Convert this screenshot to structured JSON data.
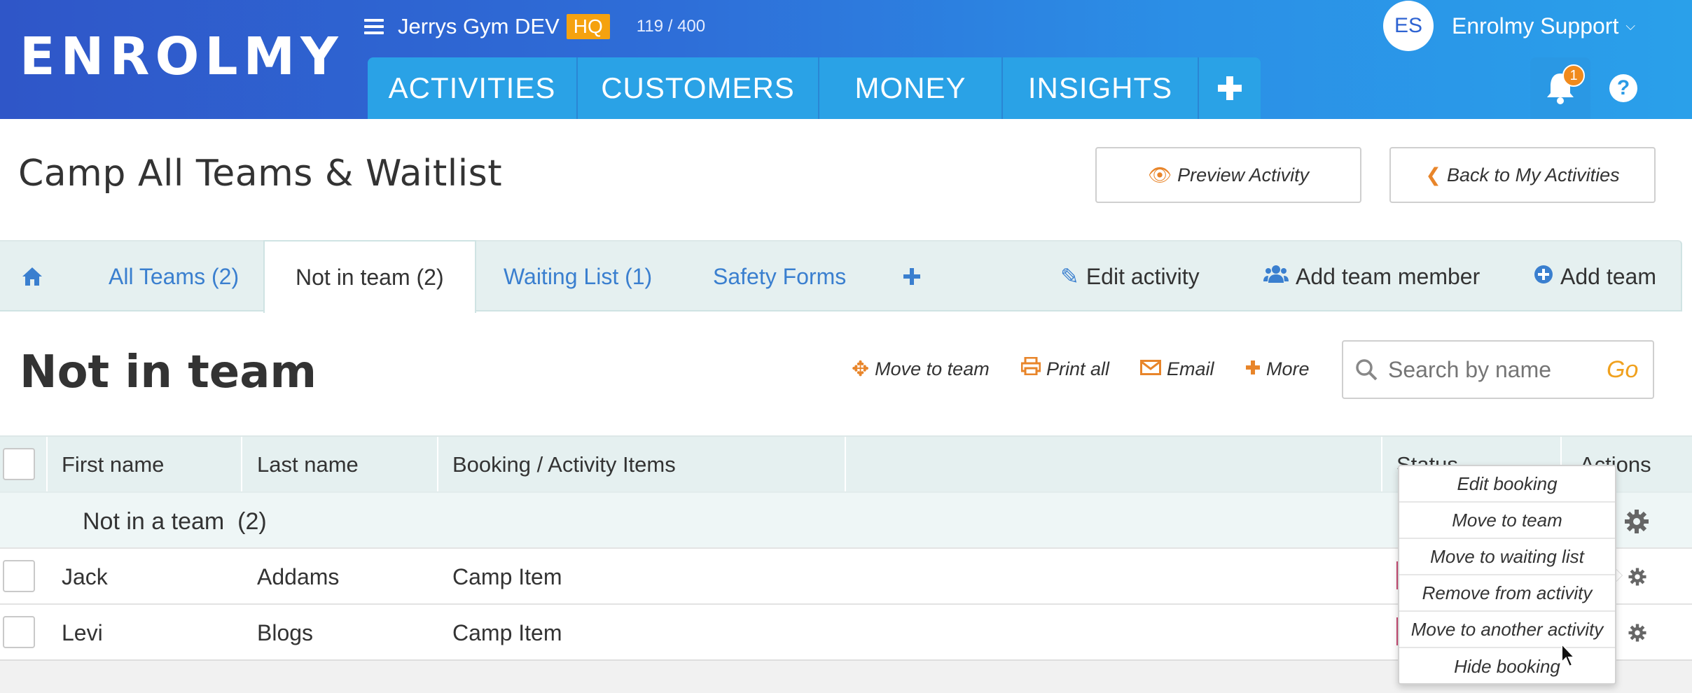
{
  "brand": {
    "logo": "ENROLMY"
  },
  "org": {
    "name": "Jerrys Gym DEV",
    "hq_badge": "HQ",
    "count": "119 / 400"
  },
  "nav": {
    "tabs": [
      "ACTIVITIES",
      "CUSTOMERS",
      "MONEY",
      "INSIGHTS"
    ],
    "add_icon": "plus-icon"
  },
  "user": {
    "initials": "ES",
    "name": "Enrolmy Support",
    "notifications": "1",
    "help": "?"
  },
  "page": {
    "title": "Camp All Teams & Waitlist",
    "preview_label": "Preview Activity",
    "back_label": "Back to My Activities"
  },
  "tabs": {
    "items": [
      "All Teams (2)",
      "Not in team (2)",
      "Waiting List (1)",
      "Safety Forms"
    ],
    "active": "Not in team (2)",
    "edit_activity": "Edit activity",
    "add_member": "Add team member",
    "add_team": "Add team"
  },
  "section": {
    "title": "Not in team",
    "move_to_team": "Move to team",
    "print_all": "Print all",
    "email": "Email",
    "more": "More",
    "search_placeholder": "Search by name",
    "go": "Go"
  },
  "table": {
    "headers": [
      "First name",
      "Last name",
      "Booking / Activity Items",
      "Status",
      "Actions"
    ],
    "group_label": "Not in a team",
    "group_count": "(2)",
    "rows": [
      {
        "first": "Jack",
        "last": "Addams",
        "item": "Camp Item"
      },
      {
        "first": "Levi",
        "last": "Blogs",
        "item": "Camp Item"
      }
    ]
  },
  "dropdown": {
    "items": [
      "Edit booking",
      "Move to team",
      "Move to waiting list",
      "Remove from activity",
      "Move to another activity",
      "Hide booking"
    ]
  },
  "colors": {
    "accent": "#2aa2e6",
    "orange": "#e8852a",
    "hq": "#f5a20f",
    "link": "#3a7fcf",
    "status": "#c94a73"
  }
}
